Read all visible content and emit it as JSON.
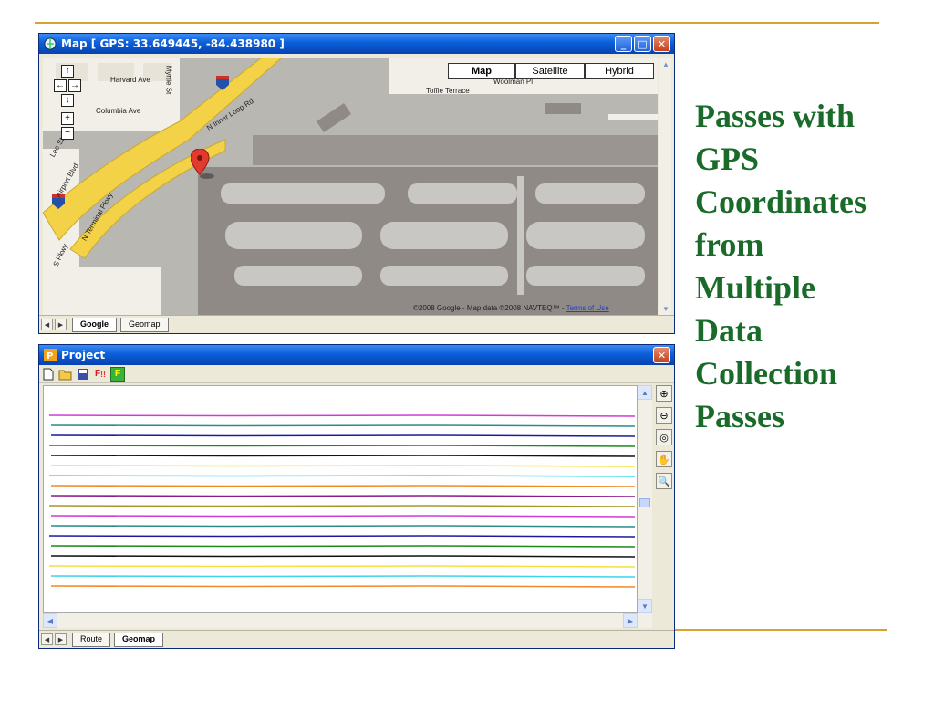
{
  "slide": {
    "title_lines": [
      "Passes with",
      "GPS",
      "Coordinates",
      "from",
      "Multiple",
      "Data",
      "Collection",
      "Passes"
    ]
  },
  "map_window": {
    "title": "Map [ GPS: 33.649445, -84.438980 ]",
    "map_types": [
      "Map",
      "Satellite",
      "Hybrid"
    ],
    "selected_map_type": "Map",
    "roads": [
      "Harvard Ave",
      "Columbia Ave",
      "N Inner Loop Rd",
      "Airport Blvd",
      "N Terminal Pkwy",
      "S Pkwy",
      "Toffie Terrace",
      "Woolman Pl",
      "Myrtle St",
      "Lee St",
      "85"
    ],
    "copyright": "©2008 Google - Map data ©2008 NAVTEQ™ - ",
    "terms_link": "Terms of Use",
    "tabs": [
      "Google",
      "Geomap"
    ],
    "active_tab": "Google",
    "colors": {
      "map_bg": "#b9b7b2",
      "runway": "#8f8a86",
      "highway": "#f4d247",
      "marker": "#e23a2e"
    }
  },
  "project_window": {
    "title": "Project",
    "toolbar_icons": [
      "new-icon",
      "open-icon",
      "save-icon",
      "flag-icon",
      "f-icon"
    ],
    "side_tools": [
      "zoom-in-icon",
      "zoom-out-icon",
      "zoom-extent-icon",
      "pan-hand-icon",
      "zoom-window-icon"
    ],
    "tabs": [
      "Route",
      "Geomap"
    ],
    "active_tab": "Geomap",
    "passes": [
      {
        "color": "#d23ad6"
      },
      {
        "color": "#2a8a8a"
      },
      {
        "color": "#1a1aa0"
      },
      {
        "color": "#1a8a1a"
      },
      {
        "color": "#111111"
      },
      {
        "color": "#f2e03a"
      },
      {
        "color": "#3ad6e6"
      },
      {
        "color": "#f08a22"
      },
      {
        "color": "#8a1a8a"
      },
      {
        "color": "#a8962a"
      },
      {
        "color": "#d23ad6"
      },
      {
        "color": "#2a8a8a"
      },
      {
        "color": "#1a1aa0"
      },
      {
        "color": "#1a8a1a"
      },
      {
        "color": "#111111"
      },
      {
        "color": "#f2e03a"
      },
      {
        "color": "#3ad6e6"
      },
      {
        "color": "#f08a22"
      }
    ]
  }
}
